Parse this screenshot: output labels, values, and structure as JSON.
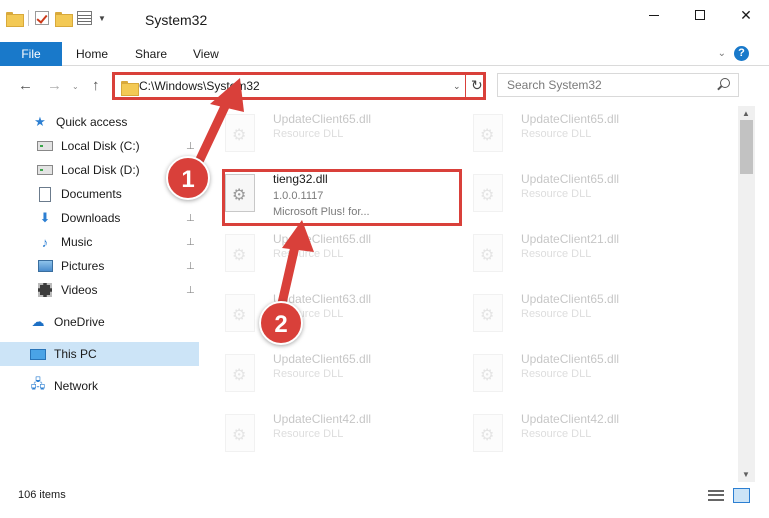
{
  "window": {
    "title": "System32",
    "minimize_icon": "minimize-icon",
    "maximize_icon": "maximize-icon",
    "close_glyph": "✕"
  },
  "ribbon": {
    "tabs": [
      {
        "label": "File"
      },
      {
        "label": "Home"
      },
      {
        "label": "Share"
      },
      {
        "label": "View"
      }
    ],
    "help_glyph": "?",
    "expand_glyph": "⌄"
  },
  "address": {
    "path": "C:\\Windows\\System32",
    "refresh_glyph": "↻",
    "chevron_glyph": "⌄"
  },
  "search": {
    "placeholder": "Search System32"
  },
  "nav": {
    "back_glyph": "←",
    "forward_glyph": "→",
    "recent_glyph": "⌄",
    "up_glyph": "↑",
    "items": [
      {
        "label": "Quick access",
        "icon": "star-icon"
      },
      {
        "label": "Local Disk (C:)",
        "icon": "drive-icon",
        "pinned": true
      },
      {
        "label": "Local Disk (D:)",
        "icon": "drive-icon"
      },
      {
        "label": "Documents",
        "icon": "documents-icon",
        "pinned": true
      },
      {
        "label": "Downloads",
        "icon": "downloads-icon",
        "pinned": true
      },
      {
        "label": "Music",
        "icon": "music-icon",
        "pinned": true
      },
      {
        "label": "Pictures",
        "icon": "pictures-icon",
        "pinned": true
      },
      {
        "label": "Videos",
        "icon": "videos-icon",
        "pinned": true
      },
      {
        "label": "OneDrive",
        "icon": "onedrive-icon"
      },
      {
        "label": "This PC",
        "icon": "this-pc-icon",
        "selected": true
      },
      {
        "label": "Network",
        "icon": "network-icon"
      }
    ],
    "pin_glyph": "📌"
  },
  "files": {
    "col1": [
      {
        "name": "UpdateClient65.dll",
        "type": "Resource DLL"
      },
      {
        "name": "tieng32.dll",
        "version": "1.0.0.1117",
        "desc": "Microsoft Plus! for...",
        "selected": true
      },
      {
        "name": "UpdateClient65.dll",
        "type": "Resource DLL"
      },
      {
        "name": "UpdateClient63.dll",
        "type": "Resource DLL"
      },
      {
        "name": "UpdateClient65.dll",
        "type": "Resource DLL"
      },
      {
        "name": "UpdateClient42.dll",
        "type": "Resource DLL"
      }
    ],
    "col2": [
      {
        "name": "UpdateClient65.dll",
        "type": "Resource DLL"
      },
      {
        "name": "UpdateClient65.dll",
        "type": "Resource DLL"
      },
      {
        "name": "UpdateClient21.dll",
        "type": "Resource DLL"
      },
      {
        "name": "UpdateClient65.dll",
        "type": "Resource DLL"
      },
      {
        "name": "UpdateClient65.dll",
        "type": "Resource DLL"
      },
      {
        "name": "UpdateClient42.dll",
        "type": "Resource DLL"
      }
    ]
  },
  "status": {
    "count": "106 items"
  },
  "callouts": {
    "one": "1",
    "two": "2"
  },
  "colors": {
    "accent": "#1979ca",
    "highlight_red": "#d9403a",
    "selected_bg": "#cce4f7"
  }
}
